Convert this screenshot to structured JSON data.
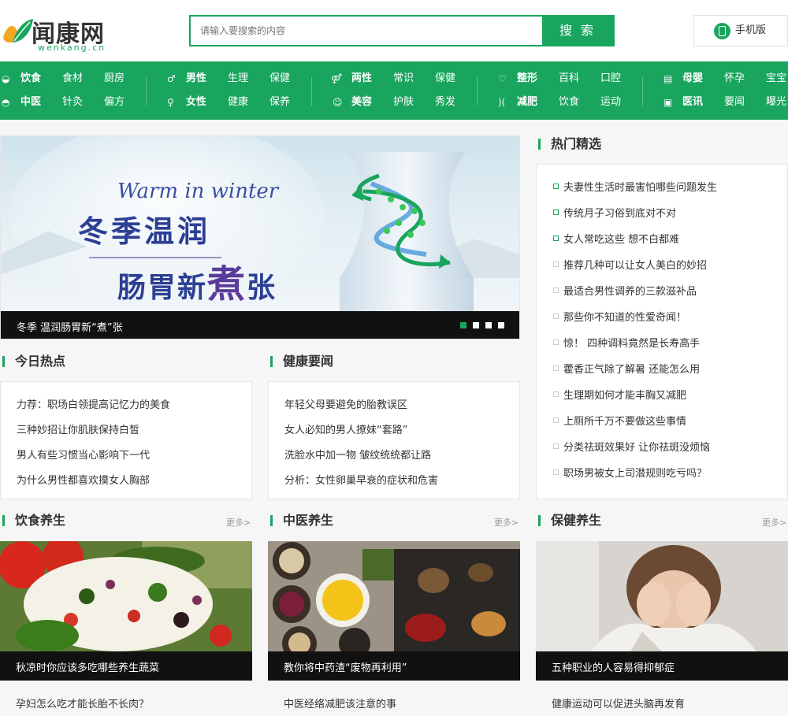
{
  "header": {
    "logo_text": "闻康网",
    "logo_sub": "wenkang.cn",
    "search_placeholder": "请输入要搜索的内容",
    "search_button": "搜 索",
    "mobile_button": "手机版"
  },
  "nav": {
    "groups": [
      {
        "rows": [
          [
            "饮食",
            "食材",
            "厨房"
          ],
          [
            "中医",
            "针灸",
            "偏方"
          ]
        ]
      },
      {
        "rows": [
          [
            "男性",
            "生理",
            "保健"
          ],
          [
            "女性",
            "健康",
            "保养"
          ]
        ]
      },
      {
        "rows": [
          [
            "两性",
            "常识",
            "保健"
          ],
          [
            "美容",
            "护肤",
            "秀发"
          ]
        ]
      },
      {
        "rows": [
          [
            "整形",
            "百科",
            "口腔"
          ],
          [
            "减肥",
            "饮食",
            "运动"
          ]
        ]
      },
      {
        "rows": [
          [
            "母婴",
            "怀孕",
            "宝宝"
          ],
          [
            "医讯",
            "要闻",
            "曝光"
          ]
        ]
      }
    ],
    "icons": [
      "bowl-icon",
      "medicine-icon",
      "male-icon",
      "female-icon",
      "couple-icon",
      "beauty-icon",
      "tooth-icon",
      "slim-icon",
      "baby-icon",
      "news-icon"
    ]
  },
  "banner": {
    "en_title": "Warm in winter",
    "title_line1": "冬季温润",
    "title_line2_a": "肠胃新",
    "title_line2_b": "煮",
    "title_line2_c": "张",
    "caption": "冬季 温润肠胃新“煮”张",
    "dots": 4
  },
  "hot": {
    "title": "热门精选",
    "items": [
      "夫妻性生活时最害怕哪些问题发生",
      "传统月子习俗到底对不对",
      "女人常吃这些 想不白都难",
      "推荐几种可以让女人美白的妙招",
      "最适合男性调养的三款滋补品",
      "那些你不知道的性爱奇闻！",
      "惊！ 四种调料竟然是长寿高手",
      "藿香正气除了解暑 还能怎么用",
      "生理期如何才能丰胸又减肥",
      "上厕所千万不要做这些事情",
      "分类祛斑效果好 让你祛斑没烦恼",
      "职场男被女上司潜规则吃亏吗？"
    ]
  },
  "today": {
    "title": "今日热点",
    "items": [
      "力荐：职场白领提高记忆力的美食",
      "三种妙招让你肌肤保持白皙",
      "男人有些习惯当心影响下一代",
      "为什么男性都喜欢摸女人胸部"
    ]
  },
  "news": {
    "title": "健康要闻",
    "items": [
      "年轻父母要避免的胎教误区",
      "女人必知的男人撩妹“套路”",
      "洗脸水中加一物 皱纹统统都让路",
      "分析：女性卵巢早衰的症状和危害"
    ]
  },
  "cards": [
    {
      "title": "饮食养生",
      "more": "更多>",
      "caption": "秋凉时你应该多吃哪些养生蔬菜",
      "link": "孕妇怎么吃才能长胎不长肉？"
    },
    {
      "title": "中医养生",
      "more": "更多>",
      "caption": "教你将中药渣“废物再利用”",
      "link": "中医经络减肥该注意的事"
    },
    {
      "title": "保健养生",
      "more": "更多>",
      "caption": "五种职业的人容易得抑郁症",
      "link": "健康运动可以促进头脑再发育"
    }
  ],
  "colors": {
    "brand": "#19a55e",
    "caption_bg": "#111111"
  }
}
